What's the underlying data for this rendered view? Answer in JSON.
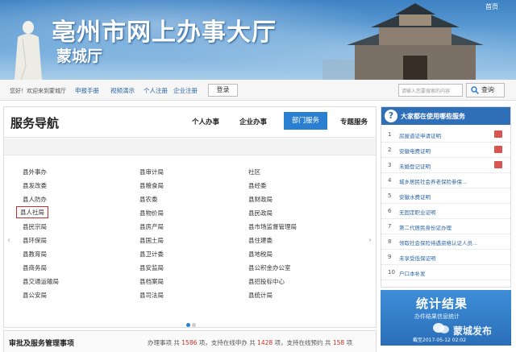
{
  "banner": {
    "title": "亳州市网上办事大厅",
    "subtitle": "蒙城厅",
    "back_link": "首页"
  },
  "loginbar": {
    "welcome": "您好！欢迎来到蒙城厅",
    "links": [
      "申报手册",
      "视频演示",
      "个人注册",
      "企业注册"
    ],
    "login_label": "登录",
    "search_placeholder": "请输入您要搜索的内容",
    "query_label": "查询"
  },
  "services": {
    "heading": "服务导航",
    "tabs": [
      "个人办事",
      "企业办事",
      "部门服务",
      "专题服务"
    ],
    "active_tab": "部门服务",
    "columns": [
      [
        "县外事办",
        "县发改委",
        "县人防办",
        "县人社局",
        "县民宗局",
        "县环保局",
        "县教育局",
        "县商务局",
        "县交通运输局",
        "县公安局"
      ],
      [
        "县审计局",
        "县粮食局",
        "县农委",
        "县物价局",
        "县房产局",
        "县国土局",
        "县卫计委",
        "县安监局",
        "县档案局",
        "县司法局"
      ],
      [
        "社区",
        "县经委",
        "县财政局",
        "县民政局",
        "县市场监督管理局",
        "县住建委",
        "县地税局",
        "县公积金办公室",
        "县招投标中心",
        "县统计局"
      ]
    ],
    "highlighted": "县人社局"
  },
  "bottombar": {
    "label": "审批及服务管理事项",
    "stat_prefix": "办理事项 共",
    "stat_total": "1586",
    "stat_mid1": "项，支持在线申办 共",
    "stat_online": "1428",
    "stat_mid2": "项，支持在线预约 共",
    "stat_appoint": "158",
    "stat_suffix": "项"
  },
  "toplist": {
    "heading": "大家都在使用哪些服务",
    "items": [
      {
        "num": "1",
        "text": "房屋道证申请证明",
        "badge": true
      },
      {
        "num": "2",
        "text": "安徽电费证明",
        "badge": true
      },
      {
        "num": "3",
        "text": "未婚登记证明",
        "badge": true
      },
      {
        "num": "4",
        "text": "城乡居民社会养老保险参保...",
        "badge": false
      },
      {
        "num": "5",
        "text": "安徽水费证明",
        "badge": false
      },
      {
        "num": "6",
        "text": "无固定职业证明",
        "badge": false
      },
      {
        "num": "7",
        "text": "第二代居民身份证办理",
        "badge": false
      },
      {
        "num": "8",
        "text": "领取社会保险待遇资格认证人员...",
        "badge": false
      },
      {
        "num": "9",
        "text": "未享受低保证明",
        "badge": false
      },
      {
        "num": "10",
        "text": "户口本补发",
        "badge": false
      }
    ]
  },
  "stats": {
    "heading": "统计结果",
    "sub": "办件结果信息统计",
    "watermark": "蒙城发布",
    "date": "截至2017-05-12 02:02"
  },
  "colors": {
    "brand_blue": "#2b7fd0",
    "banner_blue": "#3d82c4",
    "highlight_red": "#c9302c"
  }
}
